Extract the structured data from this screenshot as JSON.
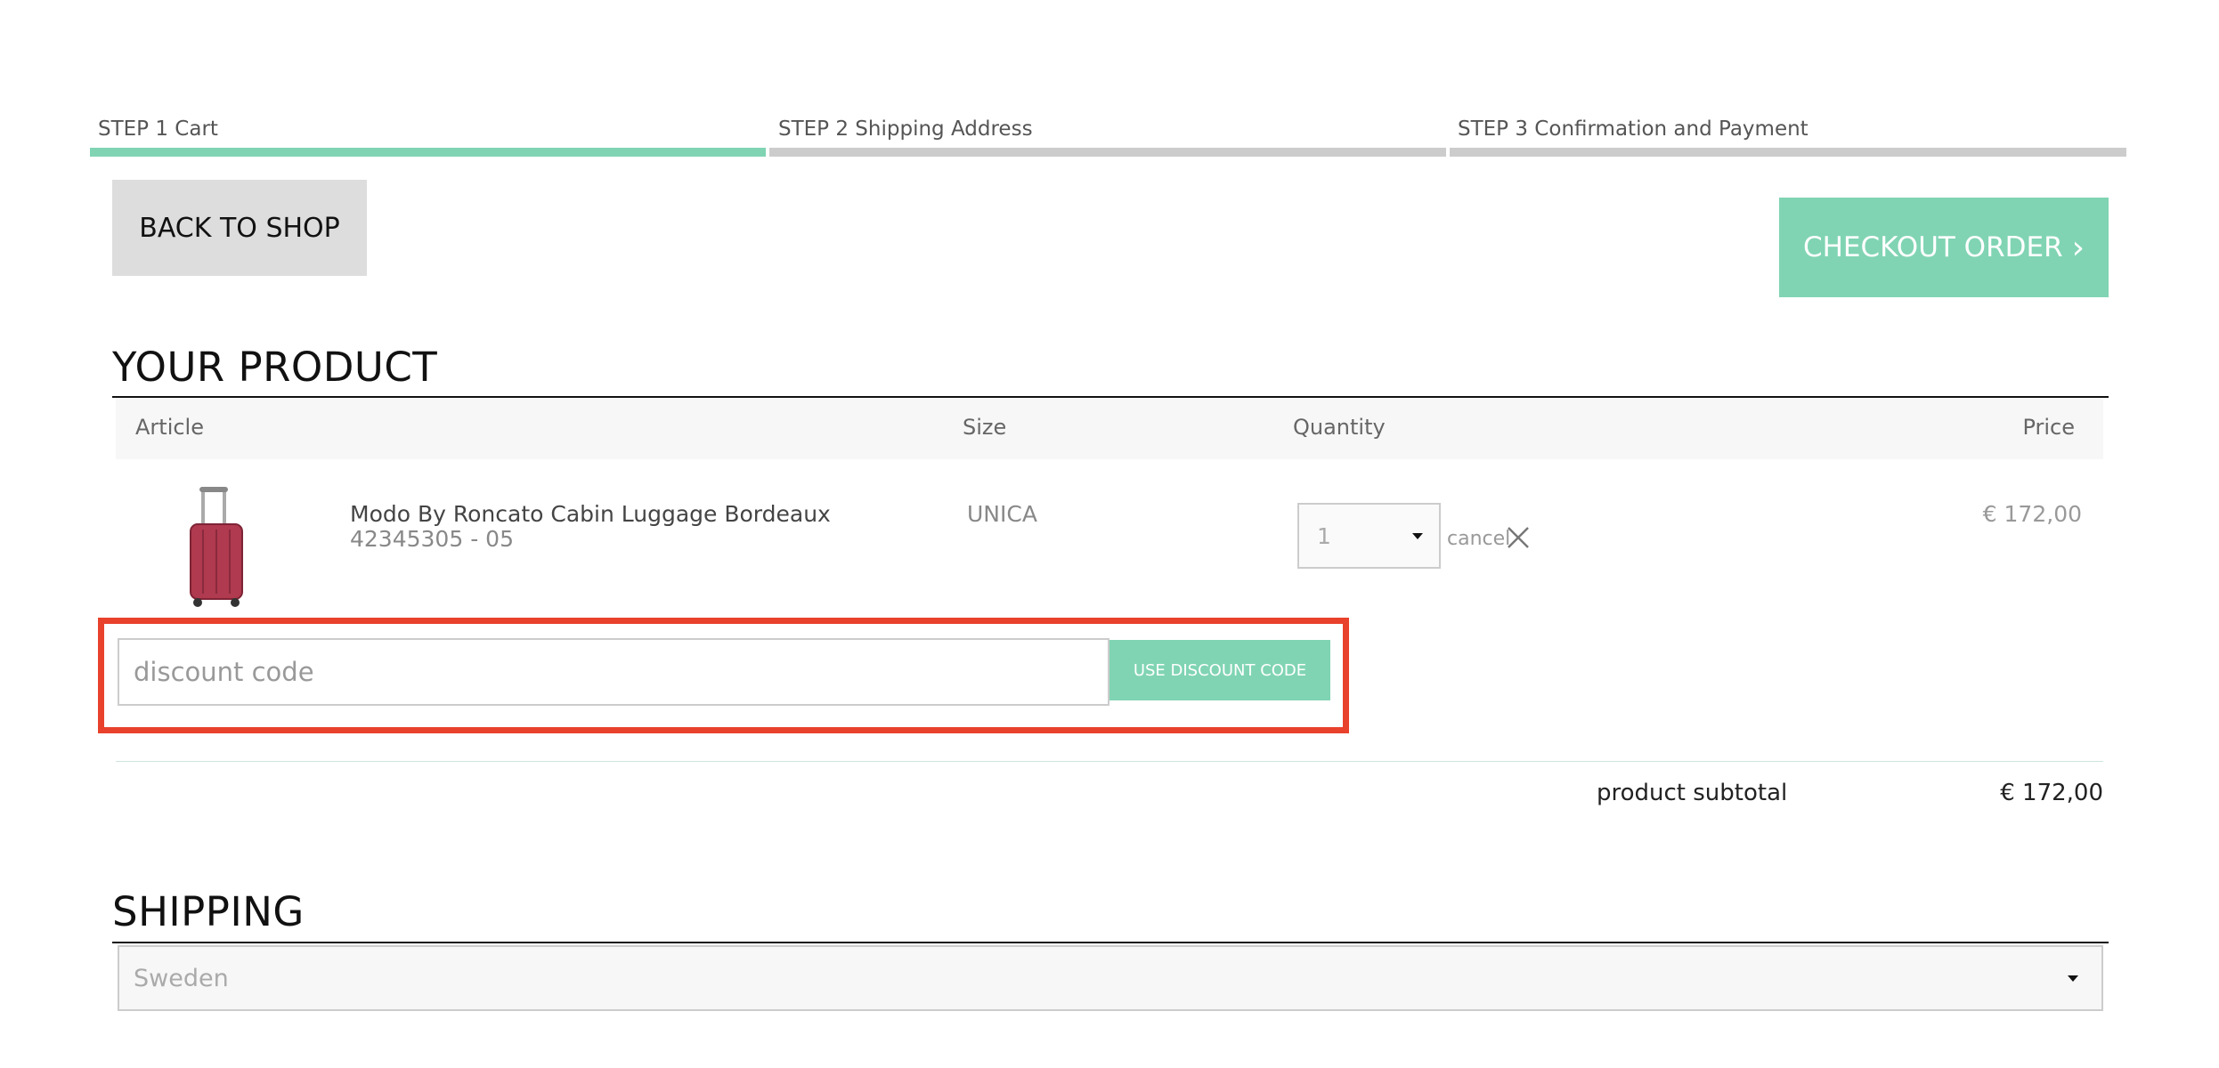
{
  "steps": [
    {
      "label": "STEP 1 Cart",
      "active": true
    },
    {
      "label": "STEP 2 Shipping Address",
      "active": false
    },
    {
      "label": "STEP 3 Confirmation and Payment",
      "active": false
    }
  ],
  "buttons": {
    "back_to_shop": "BACK TO SHOP",
    "checkout": "CHECKOUT ORDER",
    "checkout_chevron": "›",
    "use_discount": "USE DISCOUNT CODE"
  },
  "product_section": {
    "title": "YOUR PRODUCT",
    "columns": {
      "article": "Article",
      "size": "Size",
      "quantity": "Quantity",
      "price": "Price"
    },
    "item": {
      "name": "Modo By Roncato Cabin Luggage Bordeaux",
      "sku": "42345305 - 05",
      "size": "UNICA",
      "quantity": "1",
      "price": "€ 172,00",
      "cancel_label": "cancel"
    }
  },
  "discount": {
    "placeholder": "discount code"
  },
  "subtotal": {
    "label": "product subtotal",
    "value": "€ 172,00"
  },
  "shipping": {
    "title": "SHIPPING",
    "country": "Sweden"
  },
  "colors": {
    "accent": "#80d4b3",
    "highlight": "#e8412c",
    "inactive_step": "#cccccc"
  },
  "icons": {
    "close": "close-icon",
    "dropdown": "caret-down-icon",
    "product": "suitcase-image"
  }
}
